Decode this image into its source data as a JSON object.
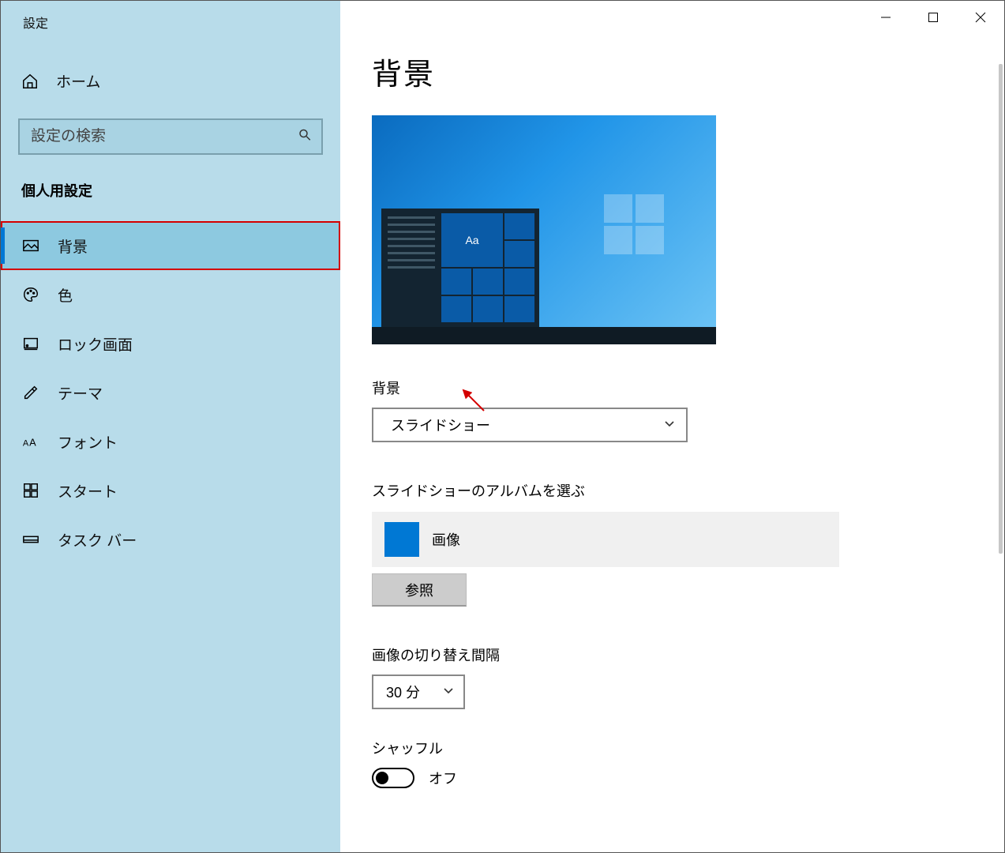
{
  "window": {
    "title": "設定"
  },
  "titlebar": {
    "minimize": "minimize",
    "maximize": "maximize",
    "close": "close"
  },
  "sidebar": {
    "home_label": "ホーム",
    "search_placeholder": "設定の検索",
    "section_header": "個人用設定",
    "items": [
      {
        "label": "背景",
        "icon": "picture"
      },
      {
        "label": "色",
        "icon": "palette"
      },
      {
        "label": "ロック画面",
        "icon": "lock-screen"
      },
      {
        "label": "テーマ",
        "icon": "theme"
      },
      {
        "label": "フォント",
        "icon": "font"
      },
      {
        "label": "スタート",
        "icon": "start"
      },
      {
        "label": "タスク バー",
        "icon": "taskbar"
      }
    ]
  },
  "main": {
    "title": "背景",
    "preview_aa": "Aa",
    "background_label": "背景",
    "background_value": "スライドショー",
    "album_label": "スライドショーのアルバムを選ぶ",
    "album_value": "画像",
    "browse_label": "参照",
    "interval_label": "画像の切り替え間隔",
    "interval_value": "30 分",
    "shuffle_label": "シャッフル",
    "shuffle_value": "オフ"
  }
}
